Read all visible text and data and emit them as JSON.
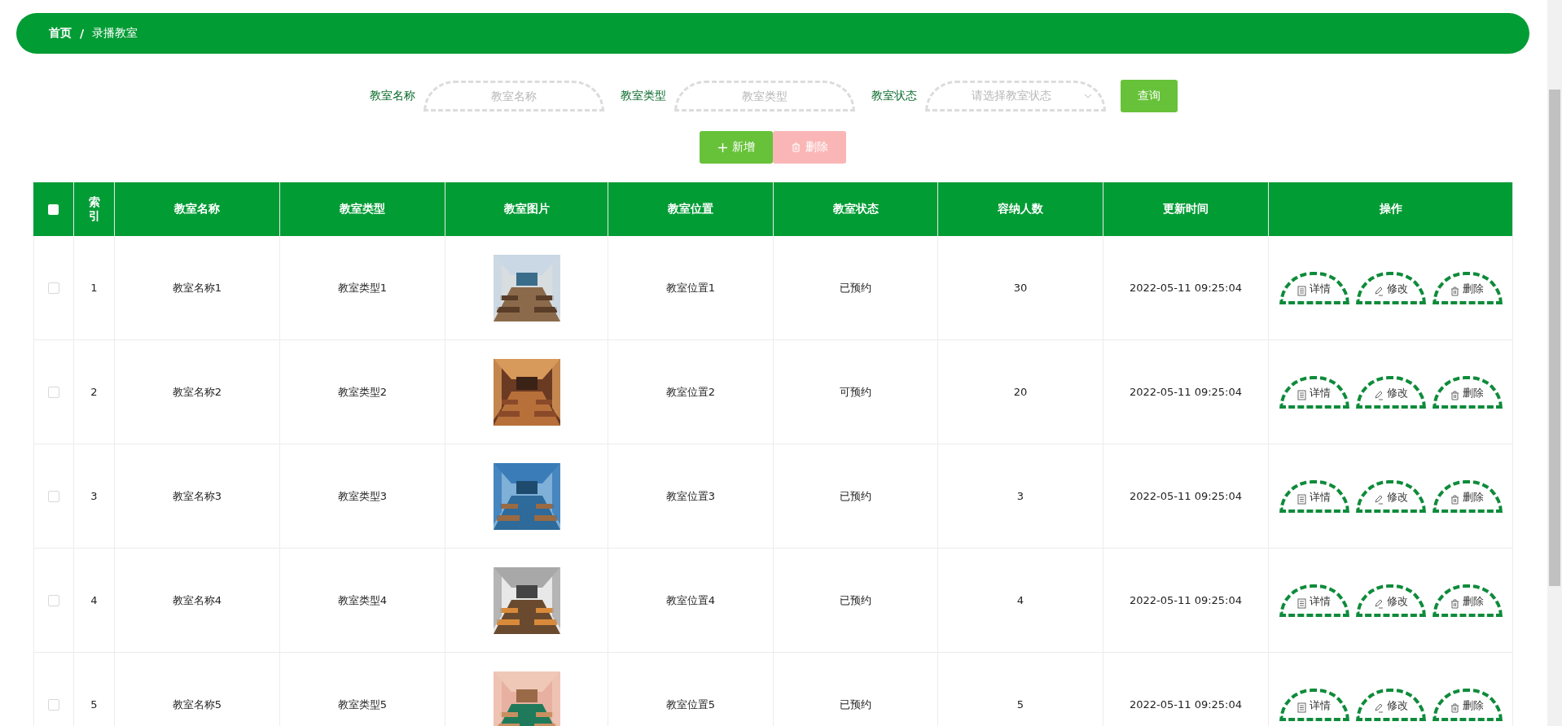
{
  "breadcrumb": [
    {
      "label": "首页",
      "current": false
    },
    {
      "label": "录播教室",
      "current": true
    }
  ],
  "breadcrumb_separator": "/",
  "search": {
    "fields": [
      {
        "kind": "input",
        "label": "教室名称",
        "placeholder": "教室名称"
      },
      {
        "kind": "input",
        "label": "教室类型",
        "placeholder": "教室类型"
      },
      {
        "kind": "select",
        "label": "教室状态",
        "placeholder": "请选择教室状态"
      }
    ],
    "button": "查询"
  },
  "actions": [
    {
      "kind": "add",
      "label": "新增",
      "disabled": false
    },
    {
      "kind": "delete",
      "label": "删除",
      "disabled": true
    }
  ],
  "table": {
    "select_all_checked": false,
    "columns": [
      "索引",
      "教室名称",
      "教室类型",
      "教室图片",
      "教室位置",
      "教室状态",
      "容纳人数",
      "更新时间",
      "操作"
    ],
    "rows": [
      {
        "checked": false,
        "index": "1",
        "name": "教室名称1",
        "type": "教室类型1",
        "location": "教室位置1",
        "status": "已预约",
        "capacity": "30",
        "updated": "2022-05-11 09:25:04",
        "ops": [
          "详情",
          "修改",
          "删除"
        ]
      },
      {
        "checked": false,
        "index": "2",
        "name": "教室名称2",
        "type": "教室类型2",
        "location": "教室位置2",
        "status": "可预约",
        "capacity": "20",
        "updated": "2022-05-11 09:25:04",
        "ops": [
          "详情",
          "修改",
          "删除"
        ]
      },
      {
        "checked": false,
        "index": "3",
        "name": "教室名称3",
        "type": "教室类型3",
        "location": "教室位置3",
        "status": "已预约",
        "capacity": "3",
        "updated": "2022-05-11 09:25:04",
        "ops": [
          "详情",
          "修改",
          "删除"
        ]
      },
      {
        "checked": false,
        "index": "4",
        "name": "教室名称4",
        "type": "教室类型4",
        "location": "教室位置4",
        "status": "已预约",
        "capacity": "4",
        "updated": "2022-05-11 09:25:04",
        "ops": [
          "详情",
          "修改",
          "删除"
        ]
      },
      {
        "checked": false,
        "index": "5",
        "name": "教室名称5",
        "type": "教室类型5",
        "location": "教室位置5",
        "status": "已预约",
        "capacity": "5",
        "updated": "2022-05-11 09:25:04",
        "ops": [
          "详情",
          "修改",
          "删除"
        ]
      }
    ]
  }
}
